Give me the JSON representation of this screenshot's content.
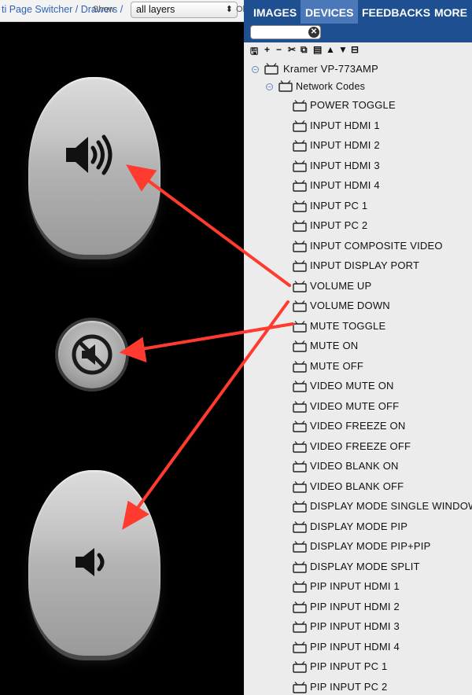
{
  "header": {
    "breadcrumb": "ti Page Switcher / Drawers /",
    "overlay_text": "Show",
    "tail_text": "Ol",
    "layer_select_value": "all layers"
  },
  "canvas": {
    "volume_up_icon": "speaker-loud-icon",
    "mute_icon": "speaker-muted-icon",
    "volume_down_icon": "speaker-quiet-icon",
    "annotation_color": "#ff3b30"
  },
  "tabs": [
    {
      "label": "IMAGES",
      "active": false
    },
    {
      "label": "DEVICES",
      "active": true
    },
    {
      "label": "FEEDBACKS",
      "active": false
    },
    {
      "label": "MORE",
      "active": false
    }
  ],
  "search": {
    "value": ""
  },
  "toolbar": [
    "save-icon",
    "add-icon",
    "remove-icon",
    "cut-icon",
    "copy-icon",
    "paste-icon",
    "move-up-icon",
    "move-down-icon",
    "collapse-icon"
  ],
  "tree": {
    "device": "Kramer VP-773AMP",
    "group": "Network Codes",
    "items": [
      "POWER TOGGLE",
      "INPUT HDMI 1",
      "INPUT HDMI 2",
      "INPUT HDMI 3",
      "INPUT HDMI 4",
      "INPUT PC 1",
      "INPUT PC 2",
      "INPUT COMPOSITE VIDEO",
      "INPUT DISPLAY PORT",
      "VOLUME UP",
      "VOLUME DOWN",
      "MUTE TOGGLE",
      "MUTE ON",
      "MUTE OFF",
      "VIDEO MUTE ON",
      "VIDEO MUTE OFF",
      "VIDEO FREEZE ON",
      "VIDEO FREEZE OFF",
      "VIDEO BLANK ON",
      "VIDEO BLANK OFF",
      "DISPLAY MODE SINGLE WINDOW",
      "DISPLAY MODE PIP",
      "DISPLAY MODE PIP+PIP",
      "DISPLAY MODE SPLIT",
      "PIP INPUT HDMI 1",
      "PIP INPUT HDMI 2",
      "PIP INPUT HDMI 3",
      "PIP INPUT HDMI 4",
      "PIP INPUT PC 1",
      "PIP INPUT PC 2"
    ]
  }
}
